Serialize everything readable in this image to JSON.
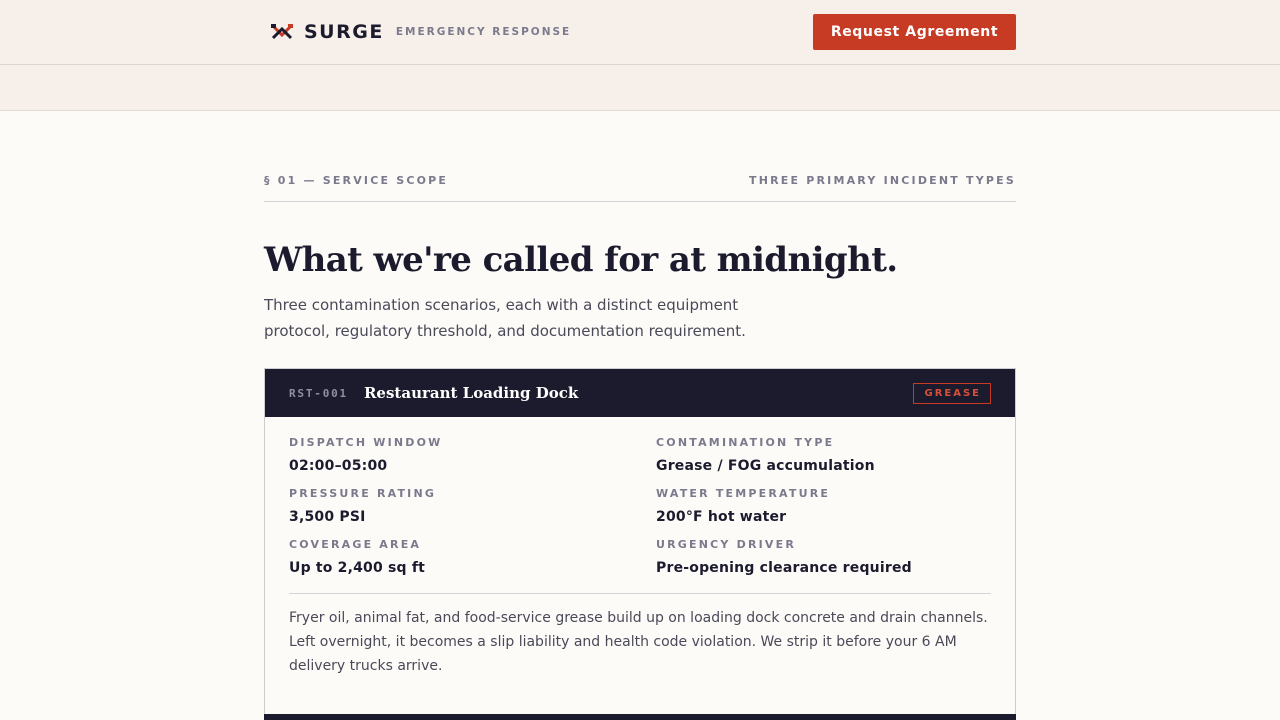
{
  "header": {
    "logo_icon": "crossed-hammer-icon",
    "brand_name": "SURGE",
    "brand_tag": "EMERGENCY RESPONSE",
    "cta_label": "Request Agreement"
  },
  "colors": {
    "accent": "#c73a23",
    "navy": "#1c1b2e",
    "cream": "#f7f0ea"
  },
  "section": {
    "eyebrow_left": "§ 01 — SERVICE SCOPE",
    "eyebrow_right": "THREE PRIMARY INCIDENT TYPES",
    "headline": "What we're called for at midnight.",
    "lede": "Three contamination scenarios, each with a distinct equipment protocol, regulatory threshold, and documentation requirement."
  },
  "incidents": [
    {
      "code": "RST-001",
      "title": "Restaurant Loading Dock",
      "badge": "GREASE",
      "specs": [
        {
          "label": "DISPATCH WINDOW",
          "value": "02:00–05:00"
        },
        {
          "label": "CONTAMINATION TYPE",
          "value": "Grease / FOG accumulation"
        },
        {
          "label": "PRESSURE RATING",
          "value": "3,500 PSI"
        },
        {
          "label": "WATER TEMPERATURE",
          "value": "200°F hot water"
        },
        {
          "label": "COVERAGE AREA",
          "value": "Up to 2,400 sq ft"
        },
        {
          "label": "URGENCY DRIVER",
          "value": "Pre-opening clearance required"
        }
      ],
      "description": "Fryer oil, animal fat, and food-service grease build up on loading dock concrete and drain channels. Left overnight, it becomes a slip liability and health code violation. We strip it before your 6 AM delivery trucks arrive."
    }
  ]
}
